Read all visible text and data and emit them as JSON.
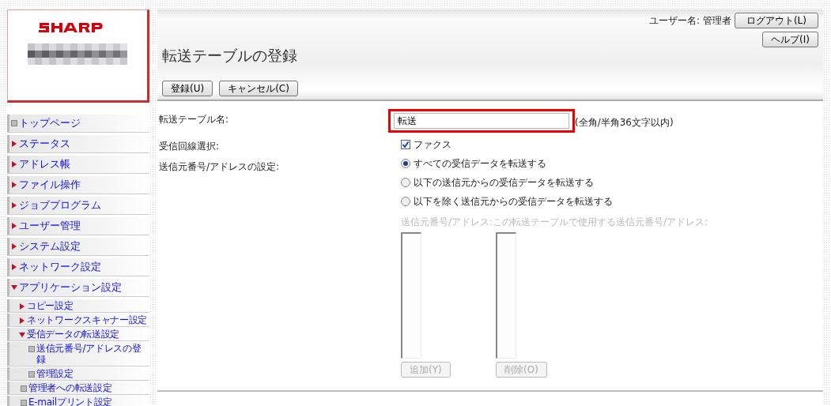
{
  "header": {
    "title": "転送テーブルの登録",
    "user_label": "ユーザー名:",
    "user_name": "管理者",
    "logout_button": "ログアウト(L)",
    "help_button": "ヘルプ(I)"
  },
  "actions": [
    {
      "label": "登録(U)"
    },
    {
      "label": "キャンセル(C)"
    }
  ],
  "menu": [
    {
      "label": "トップページ",
      "kind": "page"
    },
    {
      "label": "ステータス",
      "kind": "folder",
      "expanded": false
    },
    {
      "label": "アドレス帳",
      "kind": "folder",
      "expanded": false
    },
    {
      "label": "ファイル操作",
      "kind": "folder",
      "expanded": false
    },
    {
      "label": "ジョブプログラム",
      "kind": "folder",
      "expanded": false
    },
    {
      "label": "ユーザー管理",
      "kind": "folder",
      "expanded": false
    },
    {
      "label": "システム設定",
      "kind": "folder",
      "expanded": false
    },
    {
      "label": "ネットワーク設定",
      "kind": "folder",
      "expanded": false
    },
    {
      "label": "アプリケーション設定",
      "kind": "folder",
      "expanded": true,
      "children": [
        {
          "label": "コピー設定",
          "kind": "folder",
          "expanded": false
        },
        {
          "label": "ネットワークスキャナー設定",
          "kind": "folder",
          "expanded": false
        },
        {
          "label": "受信データの転送設定",
          "kind": "folder",
          "expanded": true,
          "children": [
            {
              "label": "送信元番号/アドレスの登録",
              "kind": "page"
            },
            {
              "label": "管理設定",
              "kind": "page"
            }
          ]
        },
        {
          "label": "管理者への転送設定",
          "kind": "page"
        },
        {
          "label": "E-mailプリント設定",
          "kind": "page"
        }
      ]
    }
  ],
  "form": {
    "name_label": "転送テーブル名:",
    "name_value": "転送",
    "name_highlighted": true,
    "name_hint": "(全角/半角36文字以内)",
    "line_label": "受信回線選択:",
    "line_option": {
      "label": "ファクス",
      "checked": true
    },
    "source_label": "送信元番号/アドレスの設定:",
    "source_options": [
      {
        "label": "すべての受信データを転送する",
        "selected": true
      },
      {
        "label": "以下の送信元からの受信データを転送する",
        "selected": false
      },
      {
        "label": "以下を除く送信元からの受信データを転送する",
        "selected": false
      }
    ],
    "lists_disabled": true,
    "available_label": "送信元番号/アドレス:",
    "used_label": "この転送テーブルで使用する送信元番号/アドレス:",
    "add_button": "追加(Y)",
    "remove_button": "削除(O)"
  }
}
